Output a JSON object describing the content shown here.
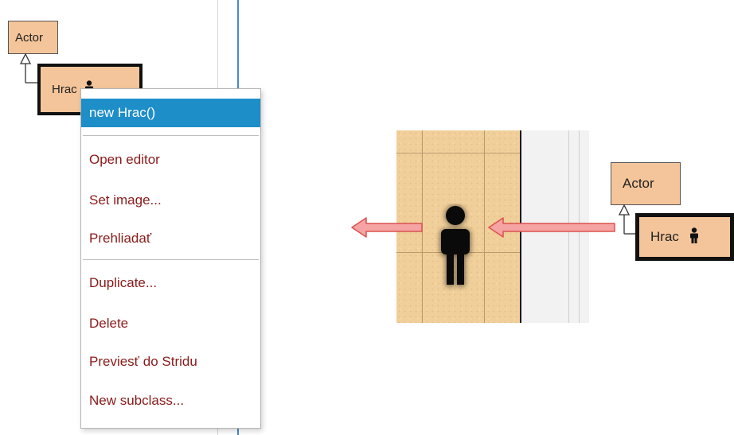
{
  "diagram": {
    "actor_class": "Actor",
    "subclass": "Hrac"
  },
  "context_menu": {
    "items": [
      {
        "label": "new Hrac()",
        "highlighted": true
      },
      {
        "label": "Open editor"
      },
      {
        "label": "Set image..."
      },
      {
        "label": "Prehliadať"
      },
      {
        "label": "Duplicate..."
      },
      {
        "label": "Delete"
      },
      {
        "label": "Previesť do Stridu"
      },
      {
        "label": "New subclass..."
      }
    ]
  },
  "illustration": {
    "actor_class": "Actor",
    "subclass": "Hrac",
    "figure_icon": "person-icon",
    "arrow_icon": "left-arrow-icon"
  },
  "colors": {
    "class_fill": "#f4c59a",
    "menu_highlight": "#1e8ec9",
    "menu_text": "#8a1a1a",
    "arrow_fill": "#f6a3a3",
    "arrow_stroke": "#d9534f"
  }
}
